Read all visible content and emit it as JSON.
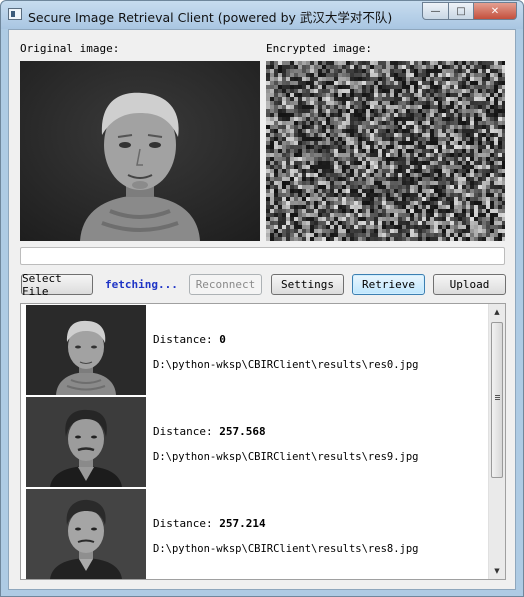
{
  "window": {
    "title": "Secure Image Retrieval Client (powered by 武汉大学对不队)",
    "buttons": [
      "minimize",
      "maximize",
      "close"
    ]
  },
  "labels": {
    "original": "Original image:",
    "encrypted": "Encrypted image:"
  },
  "progress": {
    "value": 0
  },
  "toolbar": {
    "select_file": "Select File",
    "status": "fetching...",
    "reconnect": "Reconnect",
    "settings": "Settings",
    "retrieve": "Retrieve",
    "upload": "Upload"
  },
  "results": [
    {
      "distance_label": "Distance:",
      "distance": "0",
      "path": "D:\\python-wksp\\CBIRClient\\results\\res0.jpg"
    },
    {
      "distance_label": "Distance:",
      "distance": "257.568",
      "path": "D:\\python-wksp\\CBIRClient\\results\\res9.jpg"
    },
    {
      "distance_label": "Distance:",
      "distance": "257.214",
      "path": "D:\\python-wksp\\CBIRClient\\results\\res8.jpg"
    }
  ],
  "colors": {
    "status_text": "#1f35c6",
    "default_button": "#3c7fb1",
    "title_bar": "#aecbe4"
  },
  "icons": [
    "app-icon",
    "minimize-icon",
    "maximize-icon",
    "close-icon",
    "scroll-up-icon",
    "scroll-down-icon",
    "grip-icon"
  ]
}
